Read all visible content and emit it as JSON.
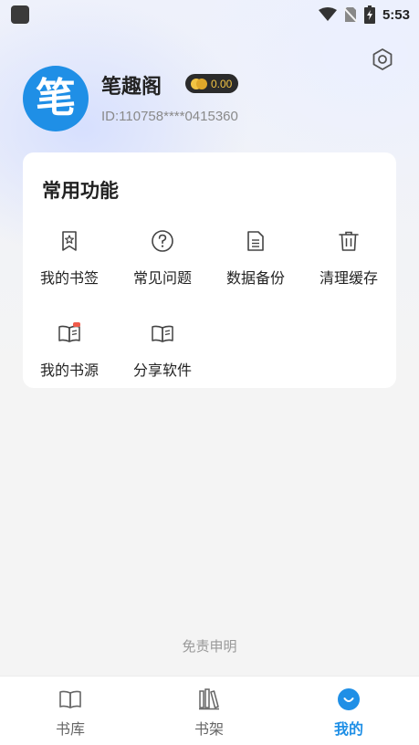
{
  "status_bar": {
    "time": "5:53"
  },
  "profile": {
    "avatar_char": "笔",
    "name": "笔趣阁",
    "coins": "0.00",
    "id_text": "ID:110758****0415360"
  },
  "functions": {
    "title": "常用功能",
    "items": [
      {
        "label": "我的书签",
        "icon": "bookmark-icon"
      },
      {
        "label": "常见问题",
        "icon": "question-circle-icon"
      },
      {
        "label": "数据备份",
        "icon": "document-icon"
      },
      {
        "label": "清理缓存",
        "icon": "trash-icon"
      },
      {
        "label": "我的书源",
        "icon": "book-source-icon"
      },
      {
        "label": "分享软件",
        "icon": "book-share-icon"
      }
    ]
  },
  "disclaimer": "免责申明",
  "nav": {
    "items": [
      {
        "label": "书库",
        "icon": "open-book-icon",
        "active": false
      },
      {
        "label": "书架",
        "icon": "bookshelf-icon",
        "active": false
      },
      {
        "label": "我的",
        "icon": "profile-smile-icon",
        "active": true
      }
    ]
  },
  "colors": {
    "accent": "#1f8fe6",
    "coin": "#f2c443"
  }
}
